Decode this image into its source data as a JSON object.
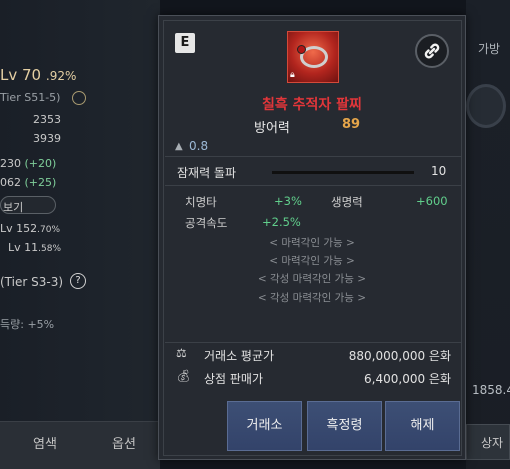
{
  "background": {
    "left": {
      "level": "Lv 70",
      "level_percent": ".92%",
      "tier_label": "Tier S51-5)",
      "val_a": "2353",
      "val_b": "3939",
      "stat_a": "230",
      "stat_a_delta": "(+20)",
      "stat_b": "062",
      "stat_b_delta": "(+25)",
      "pill_label": "보기",
      "lv_a": "Lv 152",
      "lv_a_pct": ".70%",
      "lv_b": "Lv 11",
      "lv_b_pct": ".58%",
      "tier2_label": "(Tier S3-3)",
      "drop_label": "득량: +5%",
      "tabs": [
        "염색",
        "옵션"
      ]
    },
    "right": {
      "tab_label": "가방",
      "number": "1858.4",
      "button_label": "상자"
    }
  },
  "tooltip": {
    "grade_badge": "E",
    "item_name": "칠흑 추적자 팔찌",
    "defense_label": "방어력",
    "defense_value": "89",
    "weight_value": "0.8",
    "potential_label": "잠재력 돌파",
    "potential_value": "10",
    "potential_fraction": 1.0,
    "stats": [
      {
        "name": "치명타",
        "value": "+3%"
      },
      {
        "name": "생명력",
        "value": "+600"
      },
      {
        "name": "공격속도",
        "value": "+2.5%"
      }
    ],
    "engravings": [
      "< 마력각인 가능 >",
      "< 마력각인 가능 >",
      "< 각성 마력각인 가능 >",
      "< 각성 마력각인 가능 >"
    ],
    "market_avg_label": "거래소 평균가",
    "market_avg_value": "880,000,000 은화",
    "shop_price_label": "상점 판매가",
    "shop_price_value": "6,400,000 은화",
    "buttons": {
      "exchange": "거래소",
      "black_spirit": "흑정령",
      "unequip": "해제"
    }
  },
  "colors": {
    "item_name": "#e2363a",
    "defense_value": "#e5a54a",
    "stat_value": "#61cf8c",
    "button_bg": "#3d4f75"
  }
}
